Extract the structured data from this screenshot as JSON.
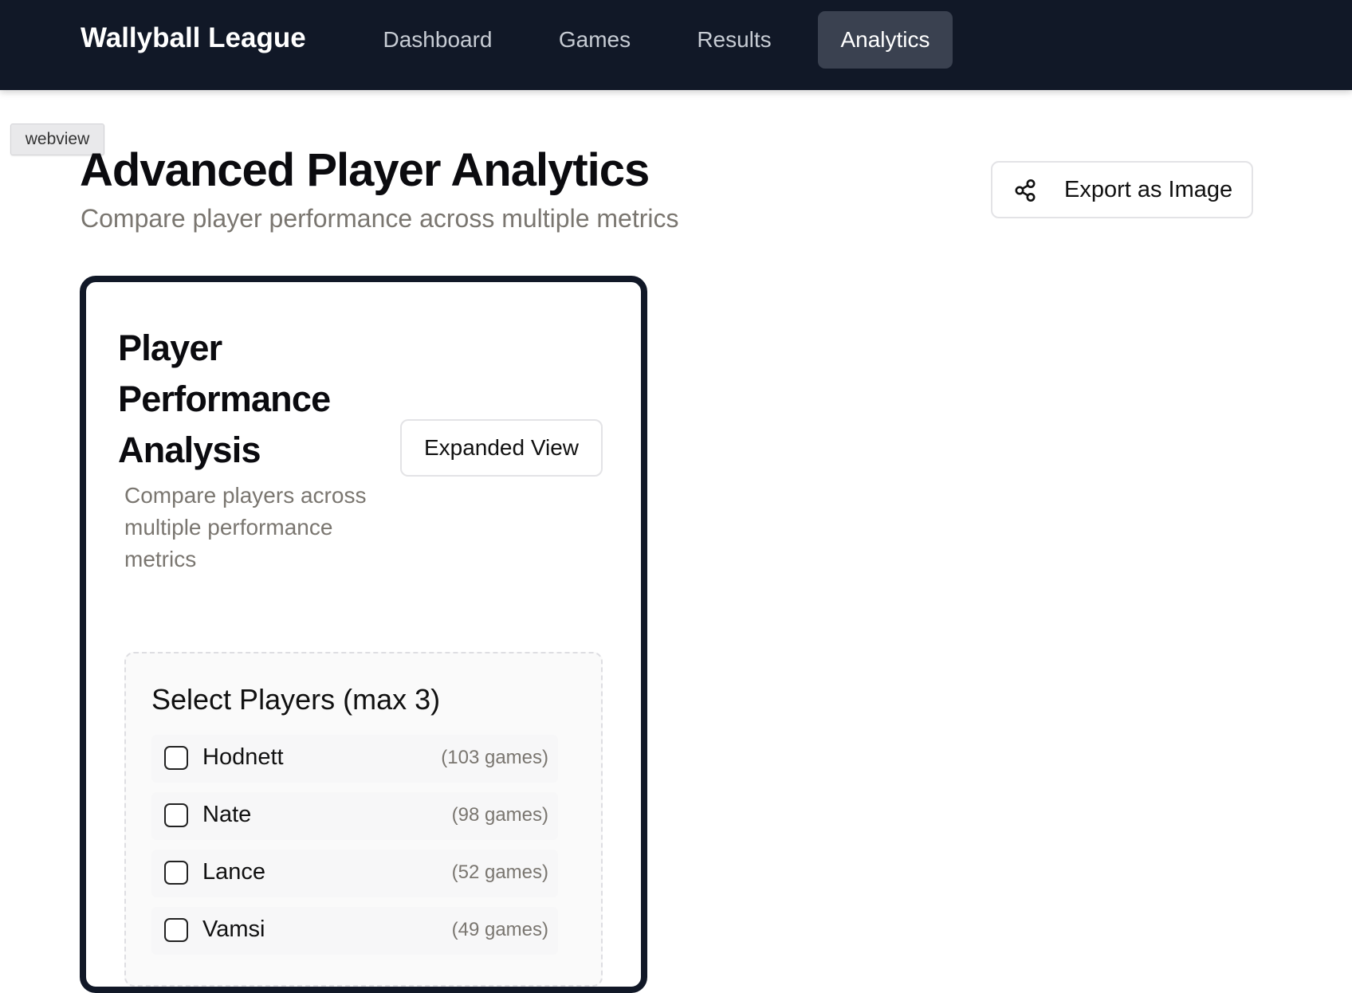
{
  "header": {
    "brand": "Wallyball League",
    "nav": [
      {
        "label": "Dashboard",
        "active": false
      },
      {
        "label": "Games",
        "active": false
      },
      {
        "label": "Results",
        "active": false
      },
      {
        "label": "Analytics",
        "active": true
      }
    ]
  },
  "webview_tag": "webview",
  "page": {
    "title": "Advanced Player Analytics",
    "subtitle": "Compare player performance across multiple metrics",
    "export_label": "Export as Image",
    "export_icon": "share-icon"
  },
  "card": {
    "title": "Player Performance Analysis",
    "description": "Compare players across multiple performance metrics",
    "expanded_label": "Expanded View",
    "select_title": "Select Players (max 3)",
    "players": [
      {
        "name": "Hodnett",
        "games": "(103 games)",
        "checked": false
      },
      {
        "name": "Nate",
        "games": "(98 games)",
        "checked": false
      },
      {
        "name": "Lance",
        "games": "(52 games)",
        "checked": false
      },
      {
        "name": "Vamsi",
        "games": "(49 games)",
        "checked": false
      }
    ]
  },
  "colors": {
    "topbar": "#111827",
    "nav_active_bg": "#3a4150",
    "muted_text": "#7a7670",
    "card_border": "#111827"
  }
}
